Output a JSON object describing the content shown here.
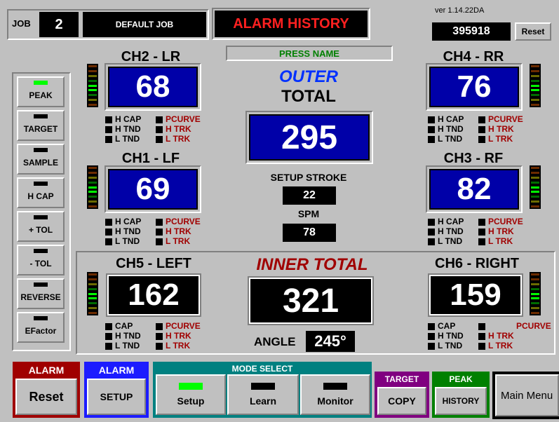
{
  "header": {
    "job_label": "JOB",
    "job_number": "2",
    "job_name": "DEFAULT JOB",
    "screen_title": "ALARM HISTORY",
    "version": "ver 1.14.22DA",
    "counter": "395918",
    "reset_label": "Reset",
    "press_name": "PRESS NAME"
  },
  "side_buttons": [
    {
      "label": "PEAK",
      "active": true
    },
    {
      "label": "TARGET",
      "active": false
    },
    {
      "label": "SAMPLE",
      "active": false
    },
    {
      "label": "H CAP",
      "active": false
    },
    {
      "label": "+ TOL",
      "active": false
    },
    {
      "label": "- TOL",
      "active": false
    },
    {
      "label": "REVERSE",
      "active": false
    },
    {
      "label": "EFactor",
      "active": false
    }
  ],
  "channels": {
    "ch2": {
      "title": "CH2 - LR",
      "value": "68",
      "flags_left": [
        "H CAP",
        "H TND",
        "L TND"
      ],
      "flags_right": [
        "PCURVE",
        "H TRK",
        "L TRK"
      ]
    },
    "ch4": {
      "title": "CH4 - RR",
      "value": "76",
      "flags_left": [
        "H CAP",
        "H TND",
        "L TND"
      ],
      "flags_right": [
        "PCURVE",
        "H TRK",
        "L TRK"
      ]
    },
    "ch1": {
      "title": "CH1 - LF",
      "value": "69",
      "flags_left": [
        "H CAP",
        "H TND",
        "L TND"
      ],
      "flags_right": [
        "PCURVE",
        "H TRK",
        "L TRK"
      ]
    },
    "ch3": {
      "title": "CH3 - RF",
      "value": "82",
      "flags_left": [
        "H CAP",
        "H TND",
        "L TND"
      ],
      "flags_right": [
        "PCURVE",
        "H TRK",
        "L TRK"
      ]
    },
    "ch5": {
      "title": "CH5 - LEFT",
      "value": "162",
      "flags_left": [
        "CAP",
        "H TND",
        "L TND"
      ],
      "flags_right": [
        "PCURVE",
        "H TRK",
        "L TRK"
      ]
    },
    "ch6": {
      "title": "CH6 - RIGHT",
      "value": "159",
      "flags_left": [
        "CAP",
        "H TND",
        "L TND"
      ],
      "flags_right": [
        "PCURVE",
        "H TRK",
        "L TRK"
      ]
    }
  },
  "outer": {
    "label_top": "OUTER",
    "label_bottom": "TOTAL",
    "value": "295"
  },
  "setup_stroke": {
    "label": "SETUP STROKE",
    "value": "22"
  },
  "spm": {
    "label": "SPM",
    "value": "78"
  },
  "inner": {
    "label": "INNER TOTAL",
    "value": "321"
  },
  "angle": {
    "label": "ANGLE",
    "value": "245°"
  },
  "bottom": {
    "alarm_reset": {
      "header": "ALARM",
      "label": "Reset"
    },
    "alarm_setup": {
      "header": "ALARM",
      "label": "SETUP"
    },
    "mode_select": {
      "header": "MODE SELECT",
      "modes": [
        {
          "label": "Setup",
          "active": true
        },
        {
          "label": "Learn",
          "active": false
        },
        {
          "label": "Monitor",
          "active": false
        }
      ]
    },
    "target_copy": {
      "header": "TARGET",
      "label": "COPY"
    },
    "peak_history": {
      "header": "PEAK",
      "label": "HISTORY"
    },
    "main_menu": {
      "label": "Main Menu"
    }
  },
  "colors": {
    "background": "#c0c0c0",
    "value_blue": "#0000a8",
    "alarm_red": "#a00000",
    "title_red": "#ff2020",
    "outer_blue": "#0030ff",
    "led_green": "#00ff00",
    "alarm_setup_blue": "#1c1cff",
    "mode_teal": "#008080",
    "target_purple": "#800080",
    "peak_green": "#008000"
  }
}
